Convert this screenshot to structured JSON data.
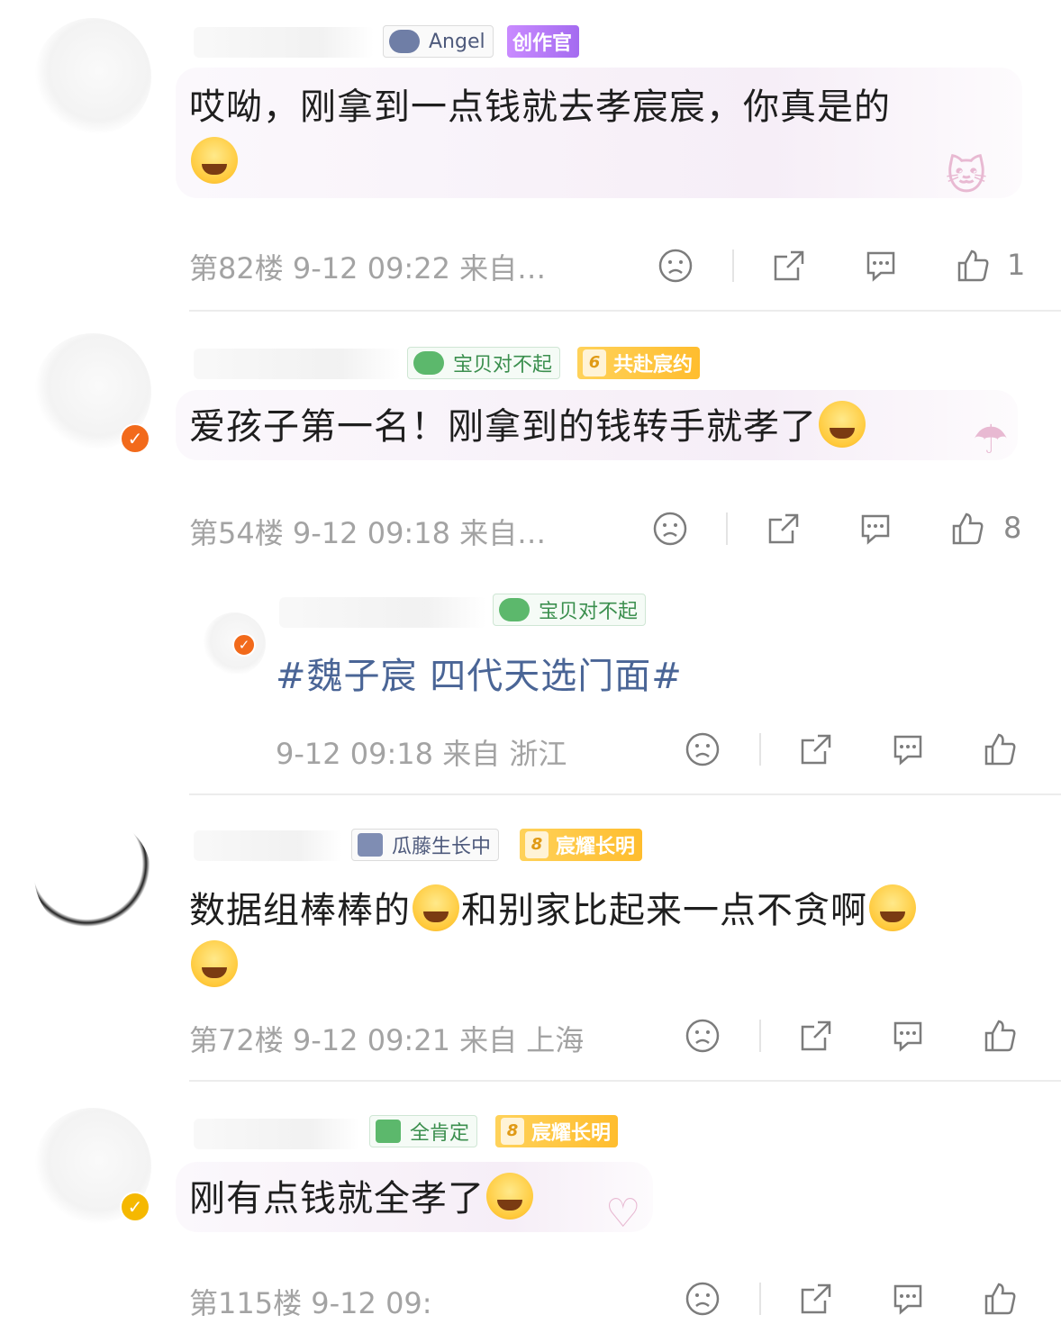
{
  "comments": [
    {
      "tags": [
        "Angel",
        "创作官"
      ],
      "text": "哎呦，刚拿到一点钱就去孝宸宸，你真是的",
      "floor": "第82楼",
      "time": "9-12 09:22",
      "location": "来自…",
      "likes": "1"
    },
    {
      "tags": [
        "宝贝对不起",
        "共赴宸约"
      ],
      "tag_level": "6",
      "text": "爱孩子第一名！刚拿到的钱转手就孝了",
      "floor": "第54楼",
      "time": "9-12 09:18",
      "location": "来自…",
      "likes": "8"
    },
    {
      "tags": [
        "宝贝对不起"
      ],
      "text": "#魏子宸 四代天选门面#",
      "floor": "",
      "time": "9-12 09:18",
      "location": "来自 浙江",
      "likes": ""
    },
    {
      "tags": [
        "瓜藤生长中",
        "宸耀长明"
      ],
      "tag_level": "8",
      "text_a": "数据组棒棒的",
      "text_b": "和别家比起来一点不贪啊",
      "floor": "第72楼",
      "time": "9-12 09:21",
      "location": "来自 上海",
      "likes": ""
    },
    {
      "tags": [
        "全肯定",
        "宸耀长明"
      ],
      "tag_level": "8",
      "text": "刚有点钱就全孝了",
      "floor": "第115楼",
      "time": "9-12 09:",
      "location": "",
      "likes": ""
    }
  ],
  "icons": {
    "dislike": "sad-face-icon",
    "share": "share-icon",
    "reply": "comment-icon",
    "like": "thumbs-up-icon"
  },
  "colors": {
    "verified_orange": "#f26a1b",
    "verified_gold": "#f5b800",
    "topic_blue": "#4a6596",
    "meta_gray": "#a3a3a3"
  }
}
